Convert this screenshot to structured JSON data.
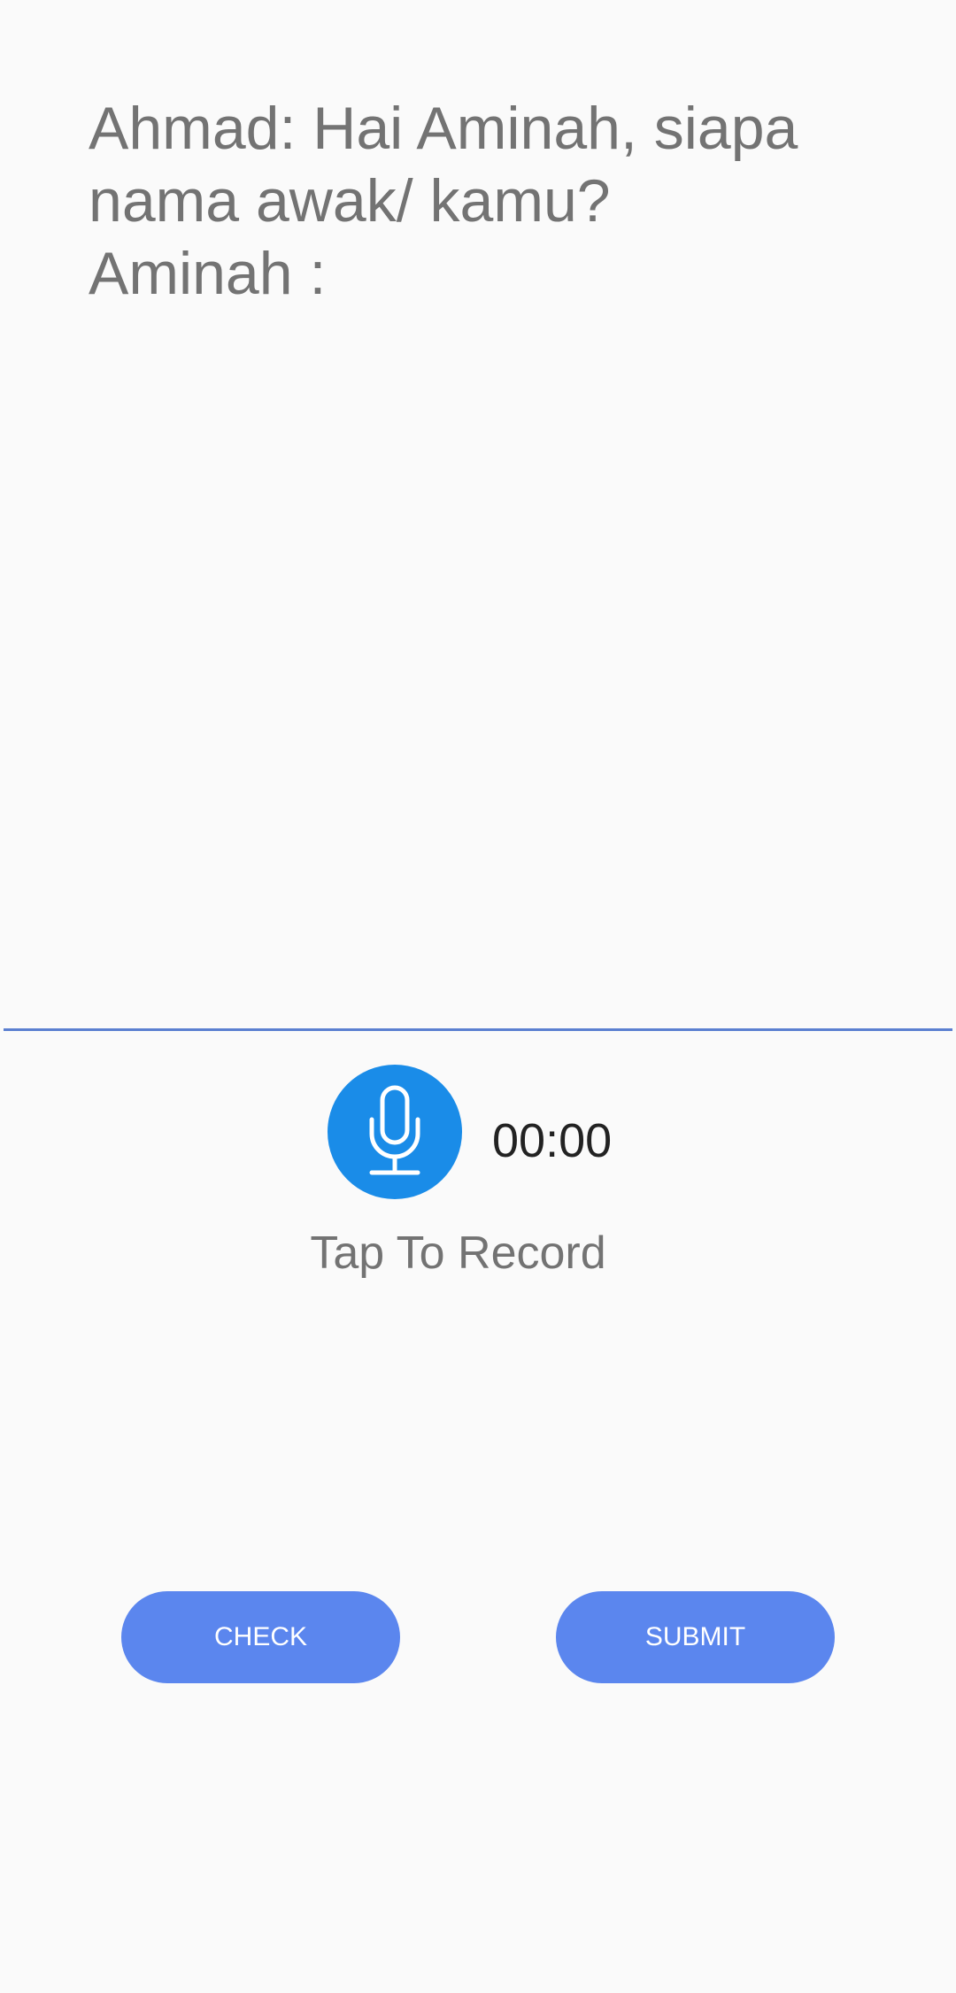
{
  "question": {
    "text": "Ahmad: Hai Aminah, siapa\nnama awak/ kamu?\nAminah :"
  },
  "recorder": {
    "timer": "00:00",
    "hint": "Tap To Record",
    "icon": "microphone-icon"
  },
  "actions": {
    "check_label": "CHECK",
    "submit_label": "SUBMIT"
  },
  "colors": {
    "accent": "#5b86ee",
    "mic": "#1a8ce8",
    "divider": "#5b7fd0"
  }
}
